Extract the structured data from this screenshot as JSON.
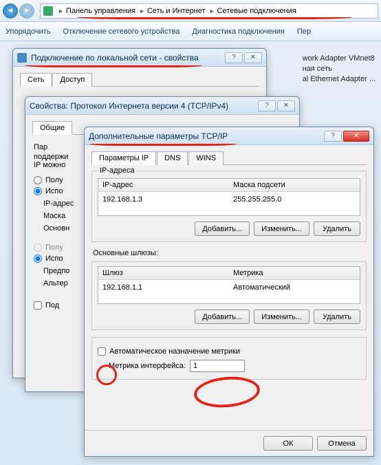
{
  "breadcrumb": {
    "items": [
      "Панель управления",
      "Сеть и Интернет",
      "Сетевые подключения"
    ]
  },
  "toolbar": {
    "item0": "Упорядочить",
    "item1": "Отключение сетевого устройства",
    "item2": "Диагностика подключения",
    "item3": "Пер"
  },
  "bg": {
    "line1": "work Adapter VMnet8",
    "line2": "ная сеть",
    "line3": "al Ethernet Adapter ..."
  },
  "win1": {
    "title": "Подключение по локальной сети - свойства",
    "tabs": {
      "t0": "Сеть",
      "t1": "Доступ"
    }
  },
  "win2": {
    "title": "Свойства: Протокол Интернета версии 4 (TCP/IPv4)",
    "tabs": {
      "t0": "Общие"
    },
    "hint1": "Пар",
    "hint2": "поддержи",
    "hint3": "IP можно",
    "radio0": "Полу",
    "radio1": "Испо",
    "lbl_ip": "IP-адрес",
    "lbl_mask": "Маска",
    "lbl_gw": "Основн",
    "radio2": "Полу",
    "radio3": "Испо",
    "lbl_pref": "Предпо",
    "lbl_alt": "Альтер",
    "chk": "Под"
  },
  "win3": {
    "title": "Дополнительные параметры TCP/IP",
    "tabs": {
      "t0": "Параметры IP",
      "t1": "DNS",
      "t2": "WINS"
    },
    "fs1": {
      "label": "IP-адреса",
      "th0": "IP-адрес",
      "th1": "Маска подсети",
      "td0": "192.168.1.3",
      "td1": "255.255.255.0"
    },
    "fs2": {
      "label": "Основные шлюзы:",
      "th0": "Шлюз",
      "th1": "Метрика",
      "td0": "192.168.1.1",
      "td1": "Автоматический"
    },
    "btns": {
      "add": "Добавить...",
      "edit": "Изменить...",
      "del": "Удалить"
    },
    "auto_metric": "Автоматическое назначение метрики",
    "metric_label": "Метрика интерфейса:",
    "metric_value": "1",
    "ok": "ОК",
    "cancel": "Отмена"
  }
}
